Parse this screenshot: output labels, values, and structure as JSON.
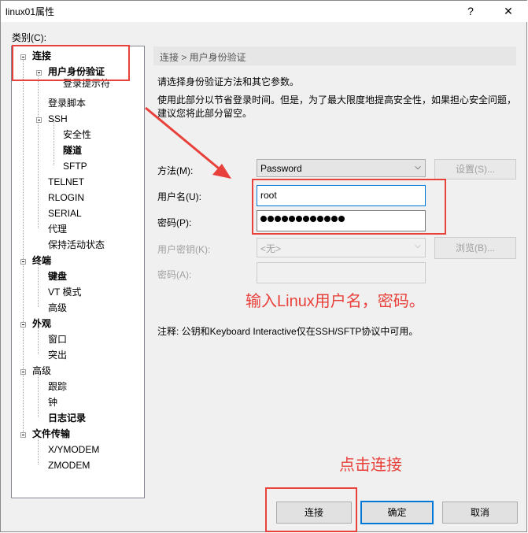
{
  "window": {
    "title": "linux01属性",
    "help_label": "?",
    "close_label": "✕"
  },
  "category_label": "类别(C):",
  "tree": [
    {
      "label": "连接",
      "bold": true
    },
    {
      "label": "用户身份验证",
      "bold": true
    },
    {
      "label": "登录提示符",
      "bold": false
    },
    {
      "label": "登录脚本",
      "bold": false
    },
    {
      "label": "SSH",
      "bold": false
    },
    {
      "label": "安全性",
      "bold": false
    },
    {
      "label": "隧道",
      "bold": true
    },
    {
      "label": "SFTP",
      "bold": false
    },
    {
      "label": "TELNET",
      "bold": false
    },
    {
      "label": "RLOGIN",
      "bold": false
    },
    {
      "label": "SERIAL",
      "bold": false
    },
    {
      "label": "代理",
      "bold": false
    },
    {
      "label": "保持活动状态",
      "bold": false
    },
    {
      "label": "终端",
      "bold": true
    },
    {
      "label": "键盘",
      "bold": true
    },
    {
      "label": "VT 模式",
      "bold": false
    },
    {
      "label": "高级",
      "bold": false
    },
    {
      "label": "外观",
      "bold": true
    },
    {
      "label": "窗口",
      "bold": false
    },
    {
      "label": "突出",
      "bold": false
    },
    {
      "label": "高级",
      "bold": false
    },
    {
      "label": "跟踪",
      "bold": false
    },
    {
      "label": "钟",
      "bold": false
    },
    {
      "label": "日志记录",
      "bold": true
    },
    {
      "label": "文件传输",
      "bold": true
    },
    {
      "label": "X/YMODEM",
      "bold": false
    },
    {
      "label": "ZMODEM",
      "bold": false
    }
  ],
  "breadcrumb": "连接 > 用户身份验证",
  "description": {
    "line1": "请选择身份验证方法和其它参数。",
    "line2": "使用此部分以节省登录时间。但是，为了最大限度地提高安全性，如果担心安全问题，",
    "line3": "建议您将此部分留空。"
  },
  "form": {
    "method_label": "方法(M):",
    "method_value": "Password",
    "settings_button": "设置(S)...",
    "username_label": "用户名(U):",
    "username_value": "root",
    "password_label": "密码(P):",
    "password_dot_count": 12,
    "userkey_label": "用户密钥(K):",
    "userkey_value": "<无>",
    "browse_button": "浏览(B)...",
    "passphrase_label": "密码(A):",
    "note": "注释: 公钥和Keyboard Interactive仅在SSH/SFTP协议中可用。"
  },
  "buttons": {
    "connect": "连接",
    "ok": "确定",
    "cancel": "取消"
  },
  "annotations": {
    "input_hint": "输入Linux用户名，密码。",
    "click_hint": "点击连接",
    "color": "#e8403a"
  }
}
